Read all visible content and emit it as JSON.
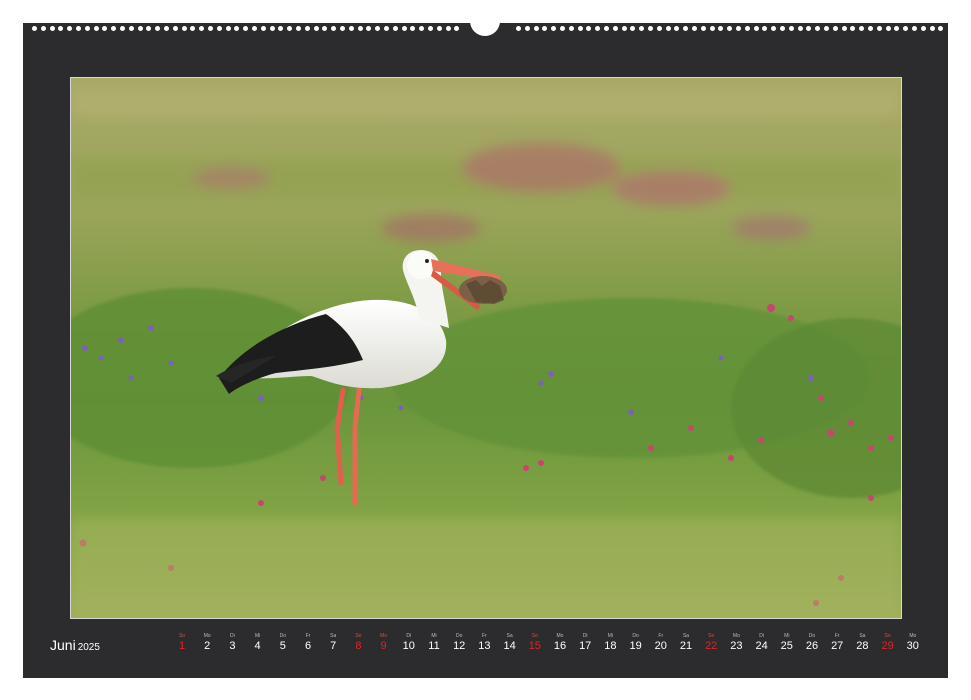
{
  "month": "Juni",
  "year": "2025",
  "days": [
    {
      "dow": "So",
      "num": "1",
      "red": true
    },
    {
      "dow": "Mo",
      "num": "2",
      "red": false
    },
    {
      "dow": "Di",
      "num": "3",
      "red": false
    },
    {
      "dow": "Mi",
      "num": "4",
      "red": false
    },
    {
      "dow": "Do",
      "num": "5",
      "red": false
    },
    {
      "dow": "Fr",
      "num": "6",
      "red": false
    },
    {
      "dow": "Sa",
      "num": "7",
      "red": false
    },
    {
      "dow": "So",
      "num": "8",
      "red": true
    },
    {
      "dow": "Mo",
      "num": "9",
      "red": true
    },
    {
      "dow": "Di",
      "num": "10",
      "red": false
    },
    {
      "dow": "Mi",
      "num": "11",
      "red": false
    },
    {
      "dow": "Do",
      "num": "12",
      "red": false
    },
    {
      "dow": "Fr",
      "num": "13",
      "red": false
    },
    {
      "dow": "Sa",
      "num": "14",
      "red": false
    },
    {
      "dow": "So",
      "num": "15",
      "red": true
    },
    {
      "dow": "Mo",
      "num": "16",
      "red": false
    },
    {
      "dow": "Di",
      "num": "17",
      "red": false
    },
    {
      "dow": "Mi",
      "num": "18",
      "red": false
    },
    {
      "dow": "Do",
      "num": "19",
      "red": false
    },
    {
      "dow": "Fr",
      "num": "20",
      "red": false
    },
    {
      "dow": "Sa",
      "num": "21",
      "red": false
    },
    {
      "dow": "So",
      "num": "22",
      "red": true
    },
    {
      "dow": "Mo",
      "num": "23",
      "red": false
    },
    {
      "dow": "Di",
      "num": "24",
      "red": false
    },
    {
      "dow": "Mi",
      "num": "25",
      "red": false
    },
    {
      "dow": "Do",
      "num": "26",
      "red": false
    },
    {
      "dow": "Fr",
      "num": "27",
      "red": false
    },
    {
      "dow": "Sa",
      "num": "28",
      "red": false
    },
    {
      "dow": "So",
      "num": "29",
      "red": true
    },
    {
      "dow": "Mo",
      "num": "30",
      "red": false
    }
  ],
  "colors": {
    "frame": "#2c2c2e",
    "weekend": "#e02424",
    "grass": "#6e9a3e",
    "flower_pink": "#c8466e",
    "flower_purple": "#7a62b8"
  },
  "photo": {
    "subject": "stork-icon"
  }
}
